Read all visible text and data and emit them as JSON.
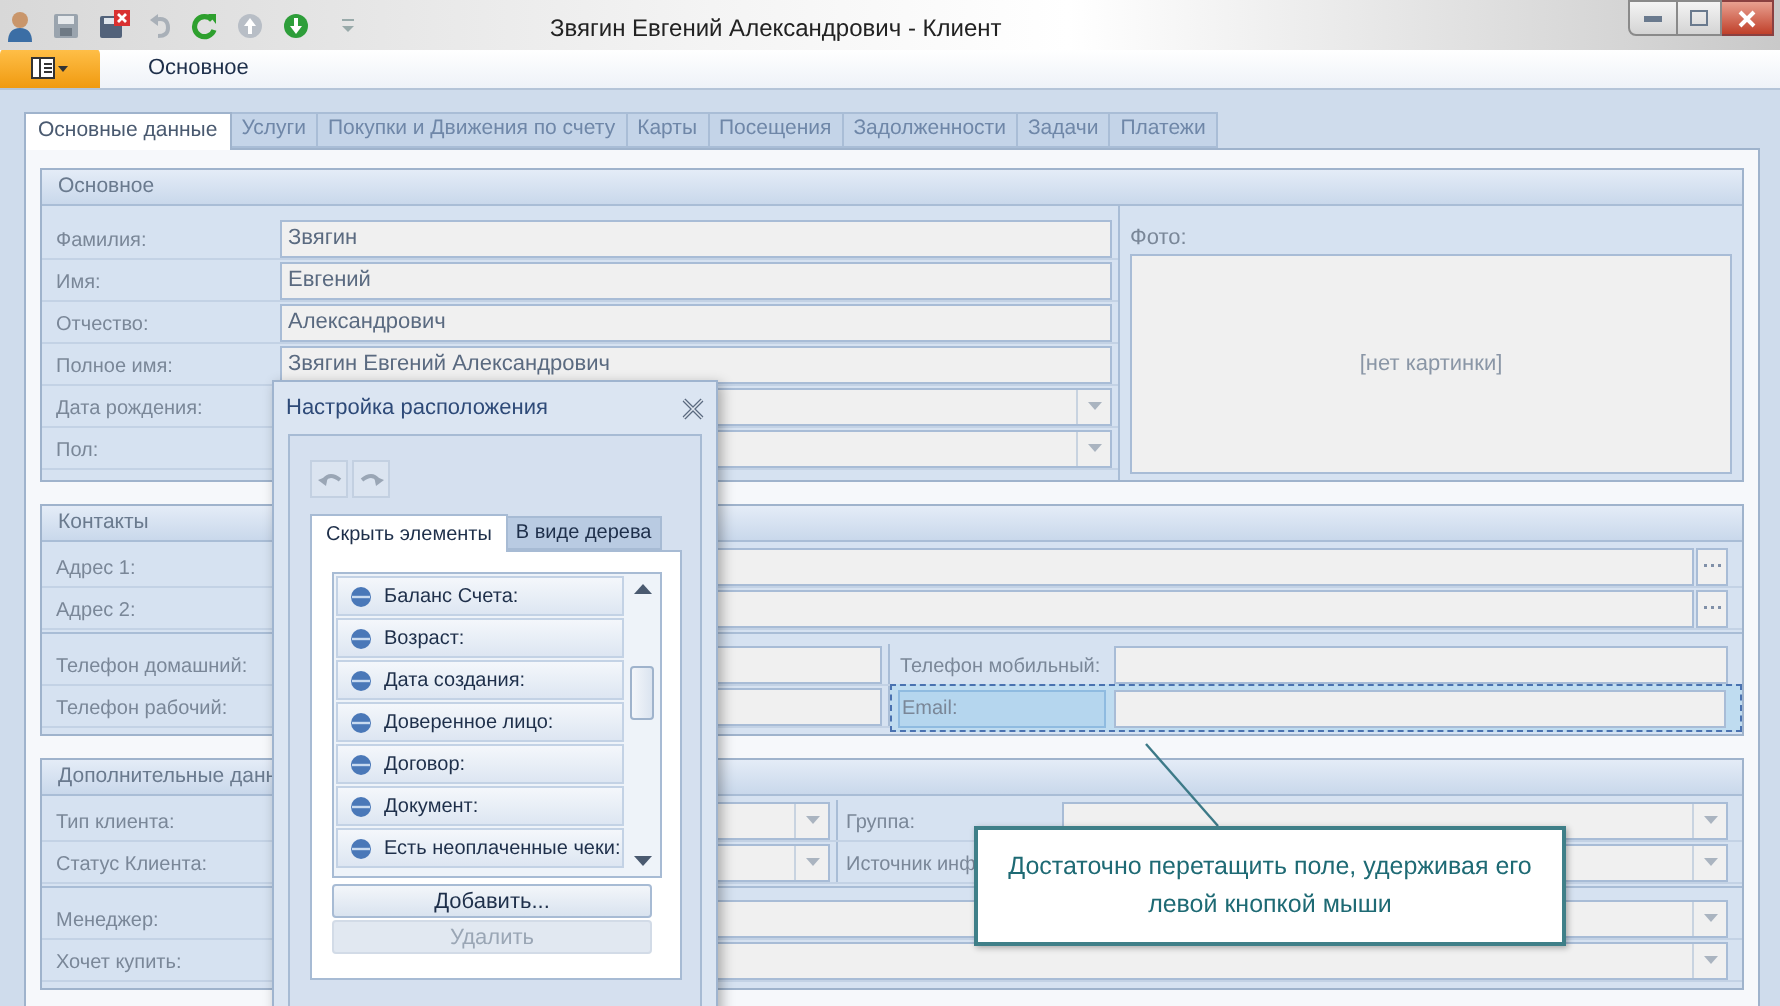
{
  "window": {
    "title": "Звягин Евгений Александрович - Клиент"
  },
  "ribbon": {
    "tabs": [
      {
        "label": "Основное",
        "selected": true
      }
    ]
  },
  "tabs": [
    {
      "label": "Основные данные",
      "selected": true
    },
    {
      "label": "Услуги",
      "selected": false
    },
    {
      "label": "Покупки и Движения по счету",
      "selected": false
    },
    {
      "label": "Карты",
      "selected": false
    },
    {
      "label": "Посещения",
      "selected": false
    },
    {
      "label": "Задолженности",
      "selected": false
    },
    {
      "label": "Задачи",
      "selected": false
    },
    {
      "label": "Платежи",
      "selected": false
    }
  ],
  "sections": [
    {
      "title": "Основное",
      "blocks": [
        {
          "rows": [
            {
              "cells": [
                {
                  "label": "Фамилия:",
                  "kind": "text",
                  "value": "Звягин",
                  "selected": false
                }
              ]
            },
            {
              "cells": [
                {
                  "label": "Имя:",
                  "kind": "text",
                  "value": "Евгений",
                  "selected": false
                }
              ]
            },
            {
              "cells": [
                {
                  "label": "Отчество:",
                  "kind": "text",
                  "value": "Александрович",
                  "selected": false
                }
              ]
            },
            {
              "cells": [
                {
                  "label": "Полное имя:",
                  "kind": "text",
                  "value": "Звягин Евгений Александрович",
                  "selected": false
                }
              ]
            },
            {
              "cells": [
                {
                  "label": "Дата рождения:",
                  "kind": "dropdown",
                  "selected": false
                }
              ]
            },
            {
              "cells": [
                {
                  "label": "Пол:",
                  "kind": "dropdown",
                  "selected": false
                }
              ]
            }
          ]
        }
      ],
      "photo": {
        "label": "Фото:",
        "placeholder": "[нет картинки]"
      }
    },
    {
      "title": "Контакты",
      "blocks": [
        {
          "rows": [
            {
              "cells": [
                {
                  "label": "Адрес 1:",
                  "kind": "browse",
                  "selected": false
                }
              ]
            },
            {
              "cells": [
                {
                  "label": "Адрес 2:",
                  "kind": "browse",
                  "selected": false
                }
              ]
            }
          ]
        },
        {
          "rows": [
            {
              "cells": [
                {
                  "label": "Телефон домашний:",
                  "kind": "text",
                  "selected": false
                },
                {
                  "label": "Телефон мобильный:",
                  "kind": "text",
                  "selected": false
                }
              ]
            },
            {
              "cells": [
                {
                  "label": "Телефон рабочий:",
                  "kind": "text",
                  "selected": false
                },
                {
                  "label": "Email:",
                  "kind": "text",
                  "selected": true
                }
              ]
            }
          ]
        }
      ]
    },
    {
      "title": "Дополнительные данн",
      "blocks": [
        {
          "rows": [
            {
              "cells": [
                {
                  "label": "Тип клиента:",
                  "kind": "dropdown",
                  "selected": false
                },
                {
                  "label": "Группа:",
                  "kind": "dropdown",
                  "selected": false
                }
              ]
            },
            {
              "cells": [
                {
                  "label": "Статус Клиента:",
                  "kind": "dropdown",
                  "selected": false
                },
                {
                  "label": "Источник инф",
                  "kind": "dropdown",
                  "selected": false
                }
              ]
            }
          ]
        },
        {
          "rows": [
            {
              "cells": [
                {
                  "label": "Менеджер:",
                  "kind": "dropdown",
                  "selected": false
                }
              ]
            },
            {
              "cells": [
                {
                  "label": "Хочет купить:",
                  "kind": "dropdown",
                  "selected": false
                }
              ]
            }
          ]
        }
      ]
    }
  ],
  "layout_dialog": {
    "title": "Настройка расположения",
    "tabs": [
      {
        "label": "Скрыть элементы",
        "selected": true
      },
      {
        "label": "В виде дерева",
        "selected": false
      }
    ],
    "items": [
      "Баланс Счета:",
      "Возраст:",
      "Дата создания:",
      "Доверенное лицо:",
      "Договор:",
      "Документ:",
      "Есть неоплаченные чеки:"
    ],
    "buttons": [
      {
        "label": "Добавить...",
        "disabled": false
      },
      {
        "label": "Удалить",
        "disabled": true
      }
    ]
  },
  "hint": {
    "text": "Достаточно перетащить поле, удерживая его левой кнопкой мыши"
  }
}
